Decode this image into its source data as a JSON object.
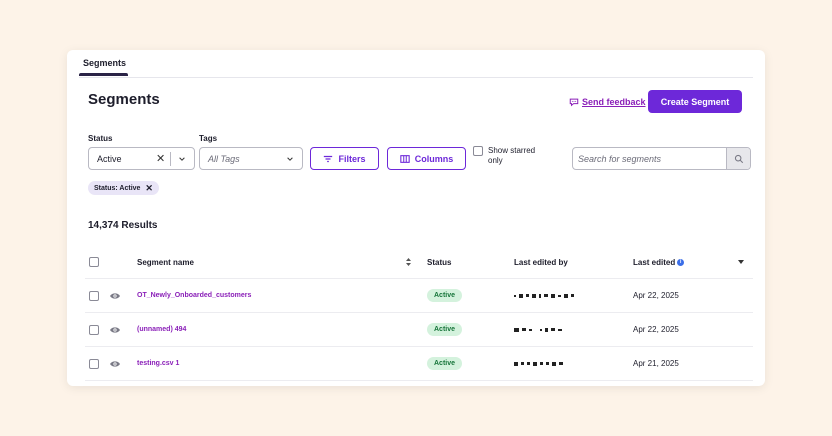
{
  "tabs": [
    {
      "label": "Segments"
    }
  ],
  "page_title": "Segments",
  "header": {
    "feedback_label": "Send feedback",
    "create_label": "Create Segment"
  },
  "filters": {
    "status_label": "Status",
    "status_value": "Active",
    "tags_label": "Tags",
    "tags_value": "All Tags",
    "filters_button": "Filters",
    "columns_button": "Columns",
    "starred_label": "Show starred only",
    "search_placeholder": "Search for segments"
  },
  "active_chip": {
    "label": "Status: Active"
  },
  "results_label": "14,374 Results",
  "table": {
    "headers": {
      "name": "Segment name",
      "status": "Status",
      "last_edited_by": "Last edited by",
      "last_edited": "Last edited"
    },
    "rows": [
      {
        "name": "OT_Newly_Onboarded_customers",
        "status": "Active",
        "date": "Apr 22, 2025"
      },
      {
        "name": "(unnamed) 494",
        "status": "Active",
        "date": "Apr 22, 2025"
      },
      {
        "name": "testing.csv 1",
        "status": "Active",
        "date": "Apr 21, 2025"
      }
    ]
  },
  "colors": {
    "accent": "#6d28d9",
    "link": "#8a1fb8",
    "badge_bg": "#d4f2dd",
    "badge_text": "#17753a",
    "page_bg": "#fdf3e8"
  },
  "icons": [
    "chat-icon",
    "close-icon",
    "chevron-down-icon",
    "filter-icon",
    "columns-icon",
    "search-icon",
    "eye-icon",
    "sort-icon",
    "info-icon",
    "caret-down-icon"
  ]
}
